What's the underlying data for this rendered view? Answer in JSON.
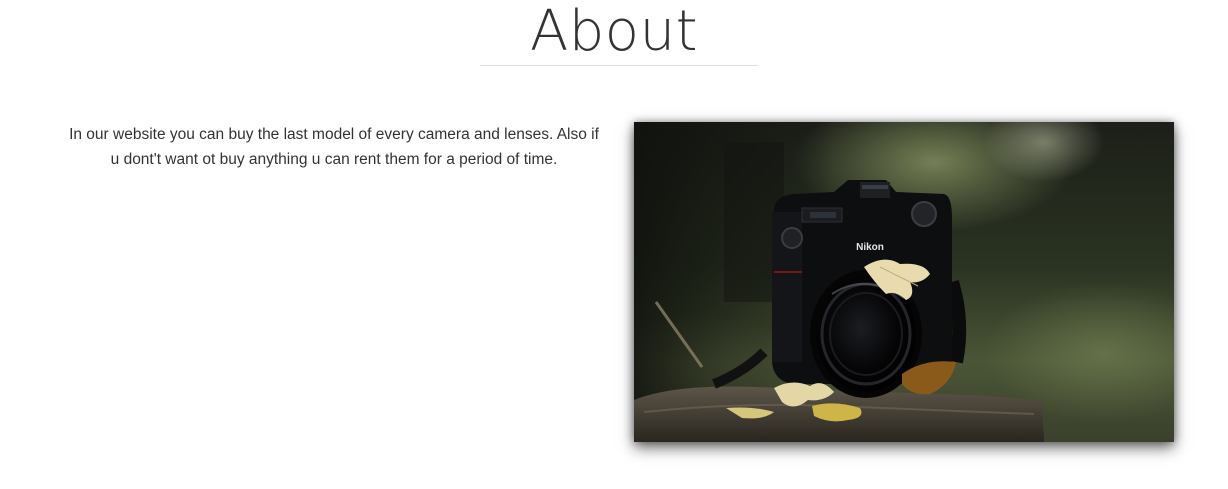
{
  "about": {
    "title": "About",
    "description": "In our website you can buy the last model of every camera and lenses. Also if u dont't want ot buy anything u can rent them for a period of time.",
    "image": {
      "subject": "camera-photo",
      "brand_text": "Nikon"
    }
  }
}
